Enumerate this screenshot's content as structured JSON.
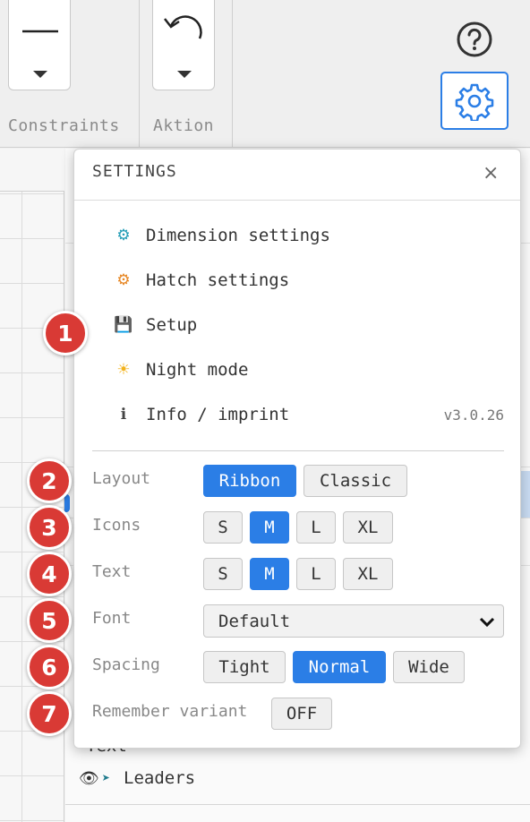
{
  "ribbon": {
    "groups": [
      {
        "label": "Constraints",
        "tool_icon": "line-icon"
      },
      {
        "label": "Aktion",
        "tool_icon": "undo-icon"
      }
    ],
    "help_icon": "help-circle-icon",
    "settings_icon": "gear-icon"
  },
  "settings": {
    "title": "SETTINGS",
    "close_label": "×",
    "menu": [
      {
        "icon": "⚙",
        "icon_color": "#1f9bb5",
        "label": "Dimension settings"
      },
      {
        "icon": "⚙",
        "icon_color": "#e6841f",
        "label": "Hatch settings"
      },
      {
        "icon": "💾",
        "icon_color": "#555555",
        "label": "Setup"
      },
      {
        "icon": "☀",
        "icon_color": "#f2b21b",
        "label": "Night mode"
      },
      {
        "icon": "ℹ",
        "icon_color": "#444444",
        "label": "Info / imprint",
        "version": "v3.0.26"
      }
    ],
    "layout": {
      "label": "Layout",
      "options": [
        "Ribbon",
        "Classic"
      ],
      "selected": "Ribbon"
    },
    "icons": {
      "label": "Icons",
      "options": [
        "S",
        "M",
        "L",
        "XL"
      ],
      "selected": "M"
    },
    "text": {
      "label": "Text",
      "options": [
        "S",
        "M",
        "L",
        "XL"
      ],
      "selected": "M"
    },
    "font": {
      "label": "Font",
      "value": "Default"
    },
    "spacing": {
      "label": "Spacing",
      "options": [
        "Tight",
        "Normal",
        "Wide"
      ],
      "selected": "Normal"
    },
    "remember": {
      "label": "Remember variant",
      "value": "OFF"
    }
  },
  "badges": [
    "1",
    "2",
    "3",
    "4",
    "5",
    "6",
    "7"
  ],
  "layers": {
    "partial_label": "Text",
    "leaders_label": "Leaders"
  },
  "colors": {
    "accent": "#2b7ee6",
    "badge": "#d93a35"
  }
}
